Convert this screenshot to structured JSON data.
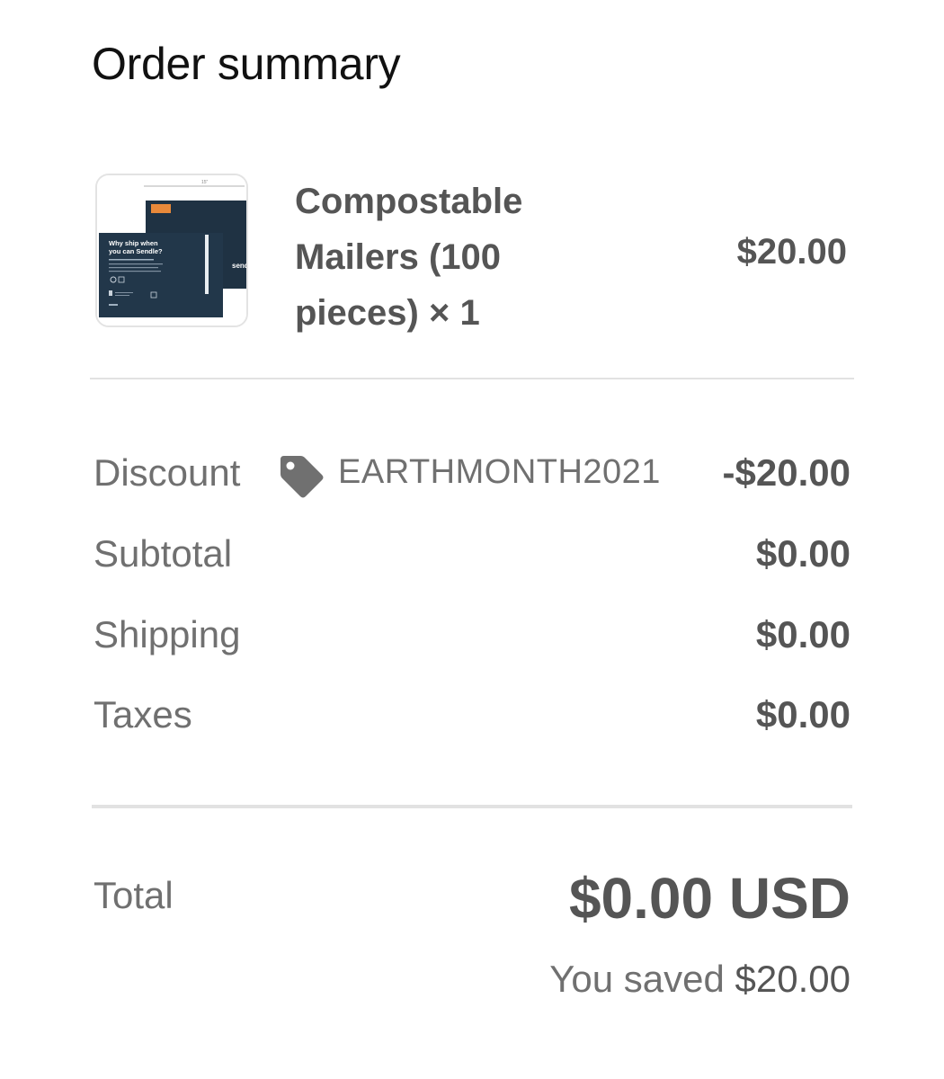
{
  "summary": {
    "title": "Order summary"
  },
  "item": {
    "name": "Compostable Mailers (100 pieces) × 1",
    "price": "$20.00",
    "image": {
      "bag_text_line1": "Why ship when",
      "bag_text_line2": "you can Sendle?",
      "brand": "sendle",
      "dimension_label": "15\""
    }
  },
  "discount": {
    "label": "Discount",
    "code": "EARTHMONTH2021",
    "amount": "-$20.00",
    "icon": "tag-icon"
  },
  "subtotal": {
    "label": "Subtotal",
    "amount": "$0.00"
  },
  "shipping": {
    "label": "Shipping",
    "amount": "$0.00"
  },
  "taxes": {
    "label": "Taxes",
    "amount": "$0.00"
  },
  "total": {
    "label": "Total",
    "amount": "$0.00 USD"
  },
  "savings": {
    "prefix": "You saved",
    "amount": "$20.00"
  },
  "colors": {
    "mailer_navy": "#1f3243",
    "mailer_label_orange": "#e8893a",
    "text_dark": "#555555",
    "text_light": "#707070"
  }
}
